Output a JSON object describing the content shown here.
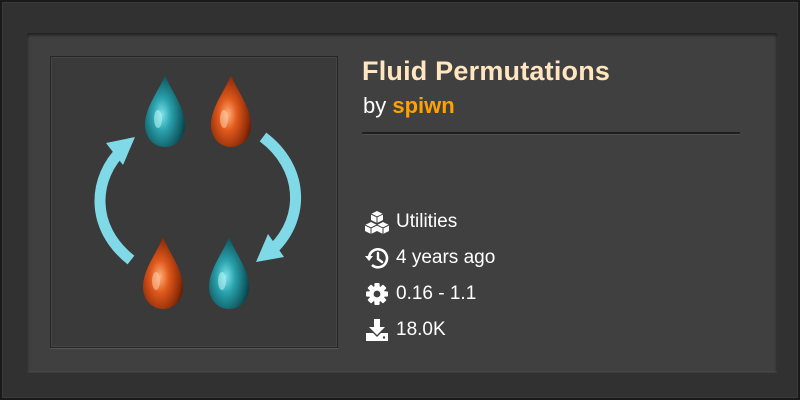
{
  "mod": {
    "title": "Fluid Permutations",
    "by_prefix": "by",
    "author": "spiwn",
    "category": "Utilities",
    "updated": "4 years ago",
    "versions": "0.16 - 1.1",
    "downloads": "18.0K"
  },
  "icons": {
    "category": "cubes-icon",
    "updated": "history-icon",
    "versions": "gear-icon",
    "downloads": "download-icon"
  },
  "colors": {
    "title": "#ffe6c0",
    "author": "#ffa200",
    "text": "#ffffff",
    "arrow": "#7fd9e6",
    "fluid_teal": "#1e8e99",
    "fluid_orange": "#d2511a"
  }
}
